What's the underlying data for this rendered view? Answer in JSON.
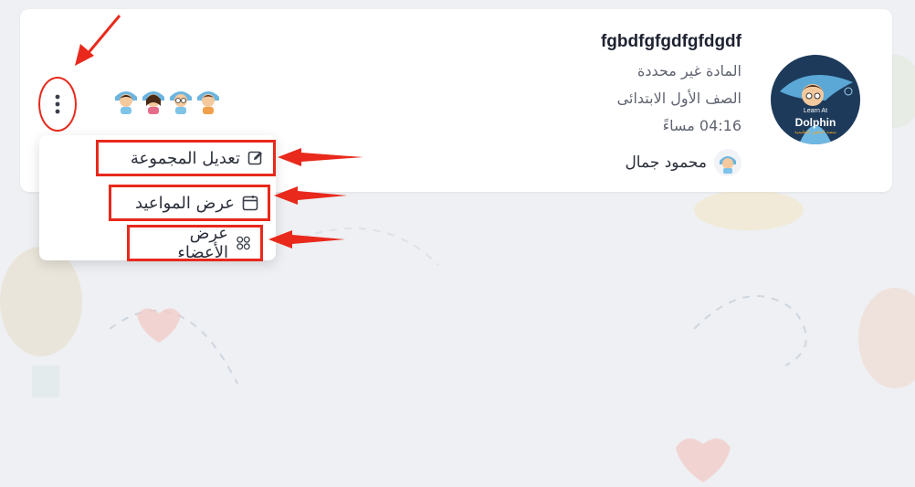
{
  "group": {
    "title": "fgbdfgfgdfgfdgdf",
    "subject": "المادة غير محددة",
    "grade": "الصف الأول الابتدائى",
    "time": "04:16 مساءً",
    "teacher_name": "محمود جمال"
  },
  "logo": {
    "line1": "Learn At",
    "line2": "Dolphin",
    "line3": "منصة الدلفين التعليمية"
  },
  "menu": {
    "edit_label": "تعديل المجموعة",
    "schedule_label": "عرض المواعيد",
    "members_label": "عرض الأعضاء"
  },
  "icons": {
    "menu": "more-vertical-icon",
    "edit": "edit-icon",
    "calendar": "calendar-icon",
    "members": "users-icon"
  },
  "colors": {
    "highlight": "#e8291c",
    "background": "#eef0f3",
    "card": "#ffffff",
    "logo_bg": "#1d3a5a"
  }
}
